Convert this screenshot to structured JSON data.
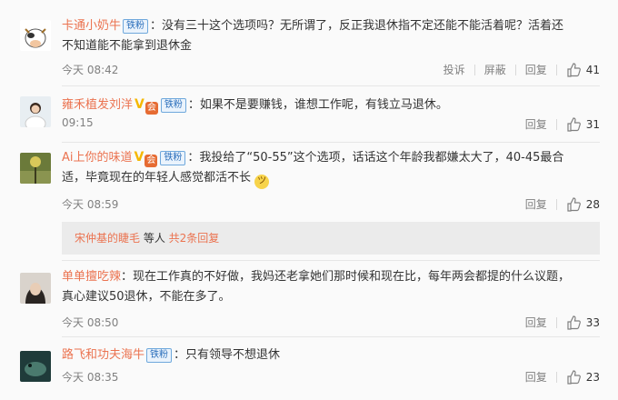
{
  "comments": [
    {
      "name": "卡通小奶牛",
      "badge": "铁粉",
      "text_line1": "：没有三十这个选项吗？无所谓了，反正我退休指不定还能不能活着呢？活着还",
      "text_line2": "不知道能不能拿到退休金",
      "time": "今天 08:42",
      "actions": [
        "投诉",
        "屏蔽",
        "回复"
      ],
      "likes": "41"
    },
    {
      "name": "雍禾植发刘洋",
      "badge": "铁粉",
      "text": "：如果不是要赚钱，谁想工作呢，有钱立马退休。",
      "time": "09:15",
      "reply": "回复",
      "likes": "31"
    },
    {
      "name": "Ai上你的味道",
      "badge": "铁粉",
      "text_line1": "：我投给了“50-55”这个选项，话话这个年龄我都嫌太大了，40-45最合",
      "text_line2": "适，毕竟现在的年轻人感觉都活不长",
      "time": "今天 08:59",
      "reply": "回复",
      "likes": "28",
      "sub_replies": {
        "user": "宋仲基的睫毛",
        "suffix": " 等人",
        "count": "共2条回复"
      }
    },
    {
      "name": "单单擅吃辣",
      "text_line1": "：现在工作真的不好做，我妈还老拿她们那时候和现在比，每年两会都提的什么议题，",
      "text_line2": "真心建议50退休，不能在多了。",
      "time": "今天 08:50",
      "reply": "回复",
      "likes": "33"
    },
    {
      "name": "路飞和功夫海牛",
      "badge": "铁粉",
      "text": "：只有领导不想退休",
      "time": "今天 08:35",
      "reply": "回复",
      "likes": "23"
    }
  ],
  "colors": {
    "name": "#eb7350",
    "text": "#333333",
    "meta": "#808080",
    "badge_border": "#6fa8dc"
  }
}
